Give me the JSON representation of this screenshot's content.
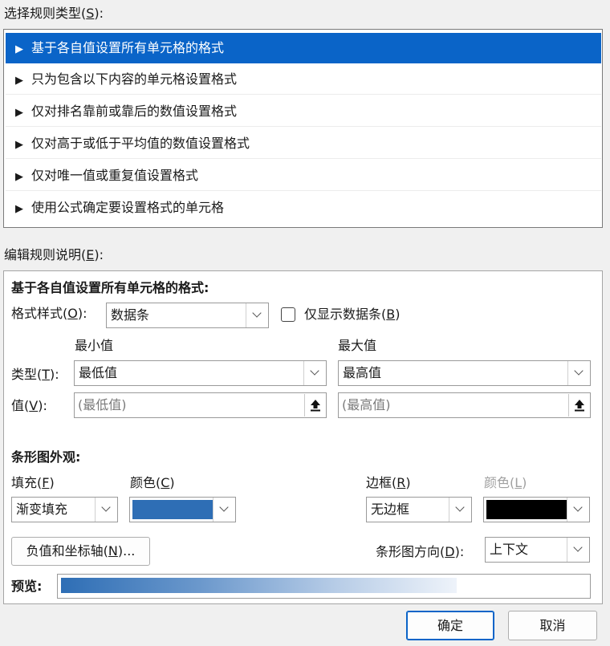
{
  "rule_type": {
    "label": "选择规则类型(",
    "key": "S",
    "label_end": "):",
    "items": [
      "基于各自值设置所有单元格的格式",
      "只为包含以下内容的单元格设置格式",
      "仅对排名靠前或靠后的数值设置格式",
      "仅对高于或低于平均值的数值设置格式",
      "仅对唯一值或重复值设置格式",
      "使用公式确定要设置格式的单元格"
    ],
    "arrow": "▶",
    "selected_index": 0
  },
  "edit": {
    "label": "编辑规则说明(",
    "key": "E",
    "label_end": "):",
    "heading": "基于各自值设置所有单元格的格式:",
    "format_style": {
      "label": "格式样式(",
      "key": "O",
      "label_end": "):",
      "value": "数据条"
    },
    "show_bar_only": {
      "label": "仅显示数据条(",
      "key": "B",
      "label_end": ")",
      "checked": false
    },
    "min_header": "最小值",
    "max_header": "最大值",
    "type": {
      "label": "类型(",
      "key": "T",
      "label_end": "):",
      "min_value": "最低值",
      "max_value": "最高值"
    },
    "value": {
      "label": "值(",
      "key": "V",
      "label_end": "):",
      "min_placeholder": "(最低值)",
      "max_placeholder": "(最高值)"
    },
    "appearance": {
      "heading": "条形图外观:",
      "fill": {
        "label": "填充(",
        "key": "F",
        "label_end": ")",
        "value": "渐变填充"
      },
      "fill_color": {
        "label": "颜色(",
        "key": "C",
        "label_end": ")",
        "color": "#2e6eb5"
      },
      "border": {
        "label": "边框(",
        "key": "R",
        "label_end": ")",
        "value": "无边框"
      },
      "border_color": {
        "label": "颜色(",
        "key": "L",
        "label_end": ")",
        "color": "#000000"
      },
      "negative_axis_button": {
        "label": "负值和坐标轴(",
        "key": "N",
        "label_end": ")..."
      },
      "direction": {
        "label": "条形图方向(",
        "key": "D",
        "label_end": "):",
        "value": "上下文"
      }
    },
    "preview_label": "预览:"
  },
  "buttons": {
    "ok": "确定",
    "cancel": "取消"
  },
  "colors": {
    "selection": "#0a64c8",
    "accent": "#0a64c8"
  }
}
